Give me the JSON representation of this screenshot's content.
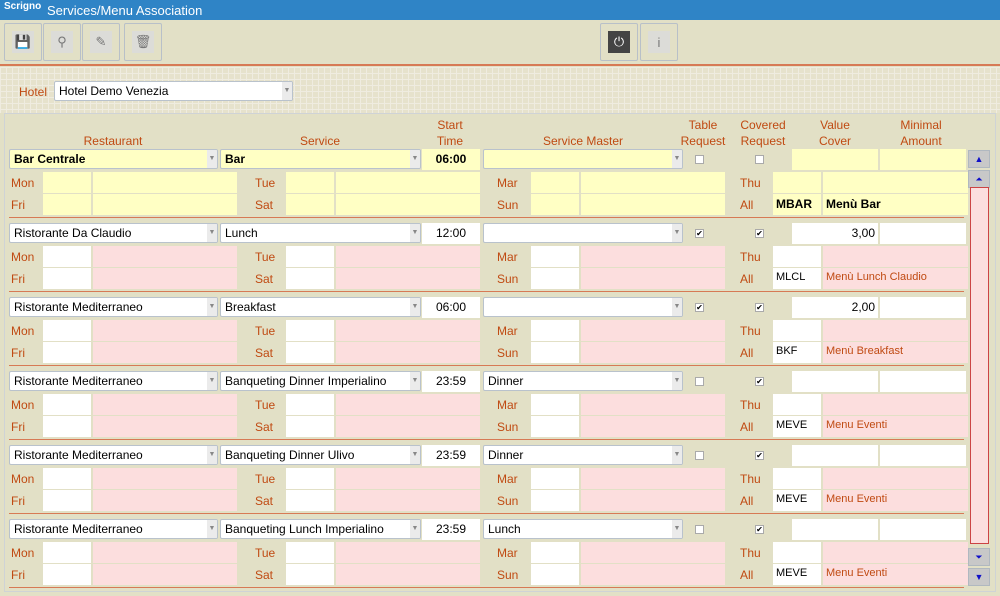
{
  "app": {
    "logo": "Scrigno",
    "title": "Services/Menu Association"
  },
  "toolbar": {
    "save": "save-icon",
    "search": "search-icon",
    "edit": "pencil-icon",
    "delete": "trash-icon",
    "power": "power-icon",
    "info": "info-icon"
  },
  "hotel": {
    "label": "Hotel",
    "value": "Hotel Demo Venezia"
  },
  "headers": {
    "restaurant": "Restaurant",
    "service": "Service",
    "start_time": "Start Time",
    "service_master": "Service Master",
    "table_request": "Table Request",
    "covered_request": "Covered Request",
    "value_cover": "Value Cover",
    "minimal_amount": "Minimal Amount"
  },
  "days": {
    "mon": "Mon",
    "tue": "Tue",
    "mar": "Mar",
    "thu": "Thu",
    "fri": "Fri",
    "sat": "Sat",
    "sun": "Sun",
    "all": "All"
  },
  "rows": [
    {
      "restaurant": "Bar Centrale",
      "service": "Bar",
      "start": "06:00",
      "master": "",
      "table": false,
      "covered": false,
      "value": "",
      "minimal": "",
      "all_code": "MBAR",
      "all_desc": "Menù Bar",
      "selected": true
    },
    {
      "restaurant": "Ristorante Da Claudio",
      "service": "Lunch",
      "start": "12:00",
      "master": "",
      "table": true,
      "covered": true,
      "value": "3,00",
      "minimal": "",
      "all_code": "MLCL",
      "all_desc": "Menù Lunch Claudio"
    },
    {
      "restaurant": "Ristorante Mediterraneo",
      "service": "Breakfast",
      "start": "06:00",
      "master": "",
      "table": true,
      "covered": true,
      "value": "2,00",
      "minimal": "",
      "all_code": "BKF",
      "all_desc": "Menù Breakfast"
    },
    {
      "restaurant": "Ristorante Mediterraneo",
      "service": "Banqueting Dinner Imperialino",
      "start": "23:59",
      "master": "Dinner",
      "table": false,
      "covered": true,
      "value": "",
      "minimal": "",
      "all_code": "MEVE",
      "all_desc": "Menu Eventi"
    },
    {
      "restaurant": "Ristorante Mediterraneo",
      "service": "Banqueting Dinner Ulivo",
      "start": "23:59",
      "master": "Dinner",
      "table": false,
      "covered": true,
      "value": "",
      "minimal": "",
      "all_code": "MEVE",
      "all_desc": "Menu Eventi"
    },
    {
      "restaurant": "Ristorante Mediterraneo",
      "service": "Banqueting Lunch Imperialino",
      "start": "23:59",
      "master": "Lunch",
      "table": false,
      "covered": true,
      "value": "",
      "minimal": "",
      "all_code": "MEVE",
      "all_desc": "Menu Eventi"
    }
  ]
}
